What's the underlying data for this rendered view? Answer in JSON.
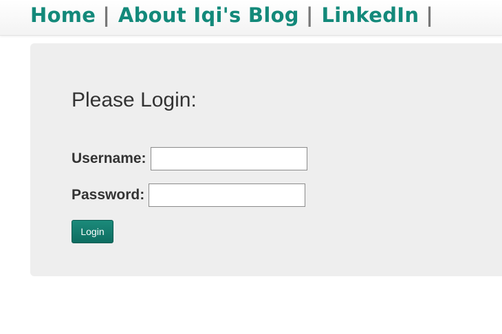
{
  "nav": {
    "links": [
      {
        "label": "Home"
      },
      {
        "label": "About Iqi's Blog"
      },
      {
        "label": "LinkedIn"
      }
    ],
    "separator": "|",
    "link_color": "#13897a",
    "separator_color": "#777777"
  },
  "login": {
    "title": "Please Login:",
    "username_label": "Username:",
    "username_value": "",
    "password_label": "Password:",
    "password_value": "",
    "button_label": "Login",
    "button_color": "#127a6c"
  }
}
